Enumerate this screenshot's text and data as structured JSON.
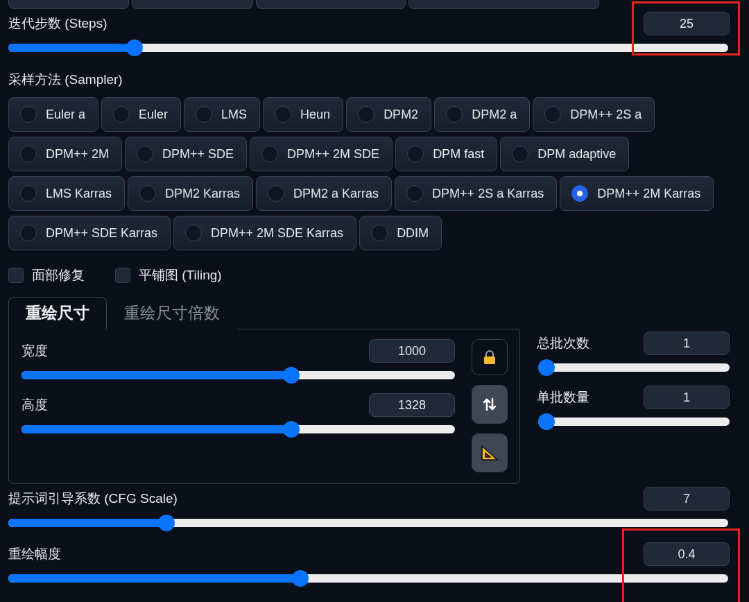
{
  "steps": {
    "label": "迭代步数 (Steps)",
    "value": "25",
    "level": 0.168,
    "highlighted": true
  },
  "sampler": {
    "label": "采样方法 (Sampler)",
    "rows": [
      {
        "options": [
          {
            "label": "Euler a",
            "selected": false
          },
          {
            "label": "Euler",
            "selected": false
          },
          {
            "label": "LMS",
            "selected": false
          },
          {
            "label": "Heun",
            "selected": false
          },
          {
            "label": "DPM2",
            "selected": false
          },
          {
            "label": "DPM2 a",
            "selected": false
          },
          {
            "label": "DPM++ 2S a",
            "selected": false
          }
        ]
      },
      {
        "options": [
          {
            "label": "DPM++ 2M",
            "selected": false
          },
          {
            "label": "DPM++ SDE",
            "selected": false
          },
          {
            "label": "DPM++ 2M SDE",
            "selected": false
          },
          {
            "label": "DPM fast",
            "selected": false
          },
          {
            "label": "DPM adaptive",
            "selected": false
          }
        ]
      },
      {
        "options": [
          {
            "label": "LMS Karras",
            "selected": false
          },
          {
            "label": "DPM2 Karras",
            "selected": false
          },
          {
            "label": "DPM2 a Karras",
            "selected": false
          },
          {
            "label": "DPM++ 2S a Karras",
            "selected": false
          },
          {
            "label": "DPM++ 2M Karras",
            "selected": true
          }
        ]
      },
      {
        "options": [
          {
            "label": "DPM++ SDE Karras",
            "selected": false
          },
          {
            "label": "DPM++ 2M SDE Karras",
            "selected": false
          },
          {
            "label": "DDIM",
            "selected": false
          }
        ]
      }
    ]
  },
  "checkboxes": [
    {
      "label": "面部修复",
      "checked": false
    },
    {
      "label": "平铺图 (Tiling)",
      "checked": false
    }
  ],
  "tabs": [
    {
      "label": "重绘尺寸",
      "selected": true
    },
    {
      "label": "重绘尺寸倍数",
      "selected": false
    }
  ],
  "size_sliders": [
    {
      "label": "宽度",
      "value": "1000",
      "level": 0.627
    },
    {
      "label": "高度",
      "value": "1328",
      "level": 0.627
    }
  ],
  "tool_buttons": [
    {
      "kind": "lock"
    },
    {
      "kind": "swap"
    },
    {
      "kind": "ratio"
    }
  ],
  "batch_sliders": [
    {
      "label": "总批次数",
      "value": "1",
      "level": 0
    },
    {
      "label": "单批数量",
      "value": "1",
      "level": 0
    }
  ],
  "cfg": {
    "label": "提示词引导系数 (CFG Scale)",
    "value": "7",
    "level": 0.213
  },
  "denoise": {
    "label": "重绘幅度",
    "value": "0.4",
    "level": 0.403,
    "highlighted": true
  }
}
